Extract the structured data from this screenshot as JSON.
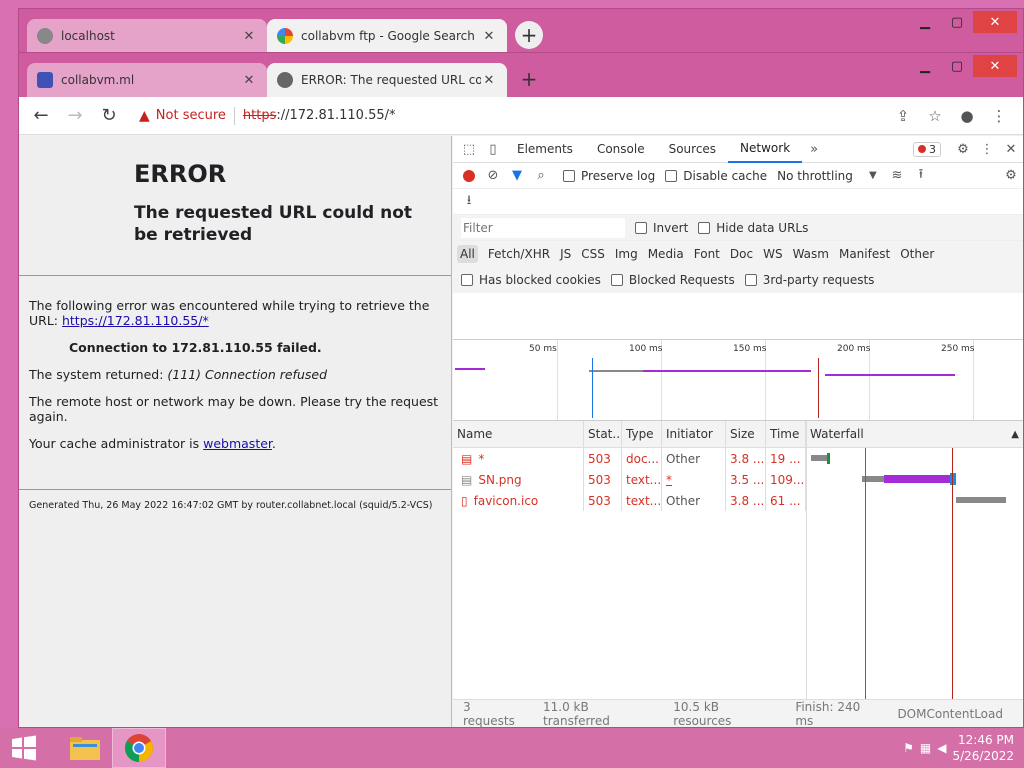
{
  "back_window": {
    "tabs": [
      {
        "title": "localhost",
        "favicon": "globe-icon",
        "active": false
      },
      {
        "title": "collabvm ftp - Google Search",
        "favicon": "google-g-icon",
        "active": true
      }
    ],
    "new_tab": "+"
  },
  "front_window": {
    "tabs": [
      {
        "title": "collabvm.ml",
        "favicon": "collabvm-logo"
      },
      {
        "title": "ERROR: The requested URL could",
        "favicon": "globe-icon"
      }
    ],
    "new_tab": "+"
  },
  "toolbar": {
    "security_label": "Not secure",
    "url_scheme": "https",
    "url_rest": "://172.81.110.55/*"
  },
  "page": {
    "title": "ERROR",
    "subtitle": "The requested URL could not be retrieved",
    "intro": "The following error was encountered while trying to retrieve the URL: ",
    "intro_link": "https://172.81.110.55/*",
    "connection": "Connection to 172.81.110.55 failed.",
    "system_returned_prefix": "The system returned: ",
    "system_returned_value": "(111) Connection refused",
    "remote_msg": "The remote host or network may be down. Please try the request again.",
    "cache_prefix": "Your cache administrator is ",
    "cache_link": "webmaster",
    "cache_suffix": ".",
    "footer": "Generated Thu, 26 May 2022 16:47:02 GMT by router.collabnet.local (squid/5.2-VCS)"
  },
  "devtools": {
    "tabs": [
      "Elements",
      "Console",
      "Sources",
      "Network"
    ],
    "active_tab": "Network",
    "more": "»",
    "error_count": "3",
    "preserve_log": "Preserve log",
    "disable_cache": "Disable cache",
    "throttling": "No throttling",
    "filter_placeholder": "Filter",
    "invert": "Invert",
    "hide_data_urls": "Hide data URLs",
    "types": [
      "All",
      "Fetch/XHR",
      "JS",
      "CSS",
      "Img",
      "Media",
      "Font",
      "Doc",
      "WS",
      "Wasm",
      "Manifest",
      "Other"
    ],
    "has_blocked_cookies": "Has blocked cookies",
    "blocked_requests": "Blocked Requests",
    "third_party": "3rd-party requests",
    "ticks": [
      "50 ms",
      "100 ms",
      "150 ms",
      "200 ms",
      "250 ms"
    ],
    "columns": [
      "Name",
      "Stat...",
      "Type",
      "Initiator",
      "Size",
      "Time",
      "Waterfall"
    ],
    "rows": [
      {
        "name": "*",
        "status": "503",
        "type": "doc...",
        "initiator": "Other",
        "size": "3.8 ...",
        "time": "19 ..."
      },
      {
        "name": "SN.png",
        "status": "503",
        "type": "text...",
        "initiator": "*",
        "size": "3.5 ...",
        "time": "109..."
      },
      {
        "name": "favicon.ico",
        "status": "503",
        "type": "text...",
        "initiator": "Other",
        "size": "3.8 ...",
        "time": "61 ..."
      }
    ],
    "status_bar": [
      "3 requests",
      "11.0 kB transferred",
      "10.5 kB resources",
      "Finish: 240 ms",
      "DOMContentLoad"
    ]
  },
  "taskbar": {
    "clock_time": "12:46 PM",
    "clock_date": "5/26/2022"
  }
}
